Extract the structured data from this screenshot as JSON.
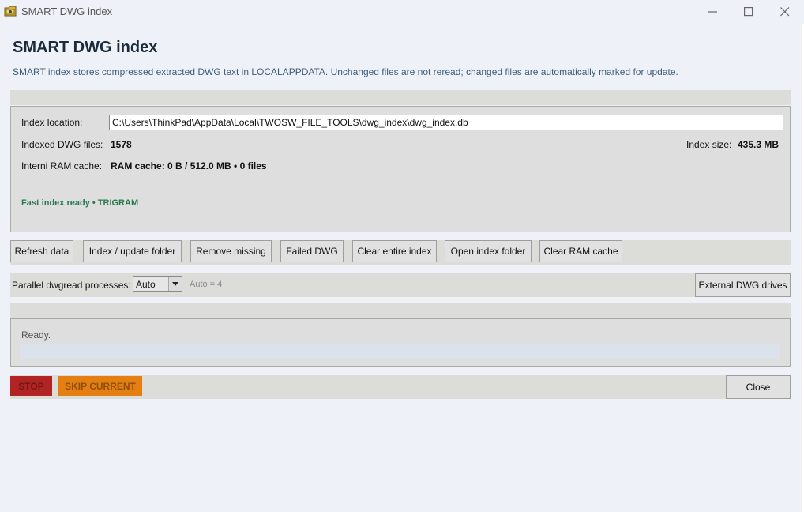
{
  "window": {
    "title": "SMART DWG index",
    "icon": "folder-app-icon"
  },
  "header": {
    "title": "SMART DWG index",
    "subtitle": "SMART index stores compressed extracted DWG text in LOCALAPPDATA. Unchanged files are not reread; changed files are automatically marked for update."
  },
  "info": {
    "location_label": "Index location:",
    "location_value": "C:\\Users\\ThinkPad\\AppData\\Local\\TWOSW_FILE_TOOLS\\dwg_index\\dwg_index.db",
    "indexed_label": "Indexed DWG files:",
    "indexed_value": "1578",
    "size_label": "Index size:",
    "size_value": "435.3 MB",
    "cache_label": "Interni RAM cache:",
    "cache_value": "RAM cache: 0 B / 512.0 MB • 0 files",
    "status": "Fast index ready • TRIGRAM",
    "status_color": "#2d7a4f"
  },
  "toolbar": {
    "buttons": [
      "Refresh data",
      "Index / update folder",
      "Remove missing",
      "Failed DWG",
      "Clear entire index",
      "Open index folder",
      "Clear RAM cache"
    ]
  },
  "parallel": {
    "label": "Parallel dwgread processes:",
    "selected": "Auto",
    "hint": "Auto = 4",
    "external_button": "External DWG drives"
  },
  "progress": {
    "status": "Ready.",
    "fraction": 0
  },
  "actions": {
    "stop": "STOP",
    "skip": "SKIP CURRENT",
    "close": "Close",
    "stop_color": "#b22323",
    "skip_color": "#e57f12"
  }
}
